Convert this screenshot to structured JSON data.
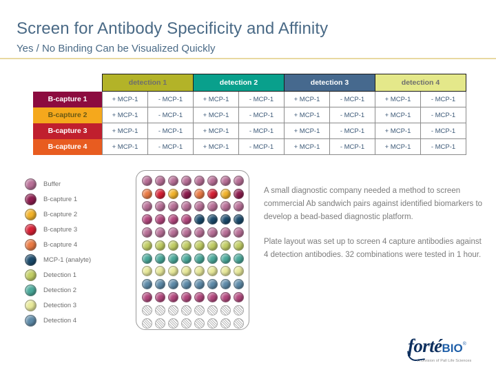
{
  "header": {
    "title": "Screen for Antibody Specificity and Affinity",
    "subtitle": "Yes / No Binding Can be Visualized Quickly",
    "title_color": "#4a6a86",
    "rule_color": "#e8d8a0"
  },
  "table": {
    "corner_label": "",
    "column_groups": [
      {
        "label": "detection 1",
        "bg": "#b3b328",
        "fg": "#6e6e6e"
      },
      {
        "label": "detection 2",
        "bg": "#09a08c",
        "fg": "#ffffff"
      },
      {
        "label": "detection 3",
        "bg": "#46698e",
        "fg": "#ffffff"
      },
      {
        "label": "detection 4",
        "bg": "#e4e88a",
        "fg": "#6e6e6e"
      }
    ],
    "subcolumns": [
      "+ MCP-1",
      "- MCP-1"
    ],
    "rows": [
      {
        "label": "B-capture 1",
        "bg": "#8c0b3f",
        "fg": "#ffffff",
        "cells": [
          "+ MCP-1",
          "- MCP-1",
          "+ MCP-1",
          "- MCP-1",
          "+ MCP-1",
          "- MCP-1",
          "+ MCP-1",
          "- MCP-1"
        ]
      },
      {
        "label": "B-capture 2",
        "bg": "#f5a81c",
        "fg": "#6b5a14",
        "cells": [
          "+ MCP-1",
          "- MCP-1",
          "+ MCP-1",
          "- MCP-1",
          "+ MCP-1",
          "- MCP-1",
          "+ MCP-1",
          "- MCP-1"
        ]
      },
      {
        "label": "B-capture 3",
        "bg": "#c01f2e",
        "fg": "#ffffff",
        "cells": [
          "+ MCP-1",
          "- MCP-1",
          "+ MCP-1",
          "- MCP-1",
          "+ MCP-1",
          "- MCP-1",
          "+ MCP-1",
          "- MCP-1"
        ]
      },
      {
        "label": "B-capture 4",
        "bg": "#e85c20",
        "fg": "#ffffff",
        "cells": [
          "+ MCP-1",
          "- MCP-1",
          "+ MCP-1",
          "- MCP-1",
          "+ MCP-1",
          "- MCP-1",
          "+ MCP-1",
          "- MCP-1"
        ]
      }
    ]
  },
  "legend": {
    "items": [
      {
        "label": "Buffer",
        "color": "#b86f97"
      },
      {
        "label": "B-capture 1",
        "color": "#8c1c4e"
      },
      {
        "label": "B-capture 2",
        "color": "#f2b32a"
      },
      {
        "label": "B-capture 3",
        "color": "#d61f34"
      },
      {
        "label": "B-capture 4",
        "color": "#ea7a44"
      },
      {
        "label": "MCP-1 (analyte)",
        "color": "#1b4a6b"
      },
      {
        "label": "Detection 1",
        "color": "#c2ce65"
      },
      {
        "label": "Detection 2",
        "color": "#4aa99a"
      },
      {
        "label": "Detection 3",
        "color": "#e8e99a"
      },
      {
        "label": "Detection 4",
        "color": "#5d8aa8"
      }
    ]
  },
  "plate": {
    "columns": 8,
    "rows": 12,
    "well_rows": [
      {
        "name": "buffer-row-1",
        "colors": [
          "#b86f97",
          "#b86f97",
          "#b86f97",
          "#b86f97",
          "#b86f97",
          "#b86f97",
          "#b86f97",
          "#b86f97"
        ]
      },
      {
        "name": "captures-row",
        "colors": [
          "#ea7a44",
          "#d61f34",
          "#f2b32a",
          "#8c1c4e",
          "#ea7a44",
          "#d61f34",
          "#f2b32a",
          "#8c1c4e"
        ]
      },
      {
        "name": "buffer-row-2",
        "colors": [
          "#b86f97",
          "#b86f97",
          "#b86f97",
          "#b86f97",
          "#b86f97",
          "#b86f97",
          "#b86f97",
          "#b86f97"
        ]
      },
      {
        "name": "analyte-row",
        "colors": [
          "#b3487e",
          "#b3487e",
          "#b3487e",
          "#b3487e",
          "#1b4a6b",
          "#1b4a6b",
          "#1b4a6b",
          "#1b4a6b"
        ]
      },
      {
        "name": "buffer-row-3",
        "colors": [
          "#b86f97",
          "#b86f97",
          "#b86f97",
          "#b86f97",
          "#b86f97",
          "#b86f97",
          "#b86f97",
          "#b86f97"
        ]
      },
      {
        "name": "detection-1-row",
        "colors": [
          "#c2ce65",
          "#c2ce65",
          "#c2ce65",
          "#c2ce65",
          "#c2ce65",
          "#c2ce65",
          "#c2ce65",
          "#c2ce65"
        ]
      },
      {
        "name": "detection-2-row",
        "colors": [
          "#4aa99a",
          "#4aa99a",
          "#4aa99a",
          "#4aa99a",
          "#4aa99a",
          "#4aa99a",
          "#4aa99a",
          "#4aa99a"
        ]
      },
      {
        "name": "detection-3-row",
        "colors": [
          "#e8e99a",
          "#e8e99a",
          "#e8e99a",
          "#e8e99a",
          "#e8e99a",
          "#e8e99a",
          "#e8e99a",
          "#e8e99a"
        ]
      },
      {
        "name": "detection-4-row",
        "colors": [
          "#5d8aa8",
          "#5d8aa8",
          "#5d8aa8",
          "#5d8aa8",
          "#5d8aa8",
          "#5d8aa8",
          "#5d8aa8",
          "#5d8aa8"
        ]
      },
      {
        "name": "buffer-row-4",
        "colors": [
          "#b3487e",
          "#b3487e",
          "#b3487e",
          "#b3487e",
          "#b3487e",
          "#b3487e",
          "#b3487e",
          "#b3487e"
        ]
      },
      {
        "name": "empty-row-1",
        "colors": [
          "empty",
          "empty",
          "empty",
          "empty",
          "empty",
          "empty",
          "empty",
          "empty"
        ]
      },
      {
        "name": "empty-row-2",
        "colors": [
          "empty",
          "empty",
          "empty",
          "empty",
          "empty",
          "empty",
          "empty",
          "empty"
        ]
      }
    ]
  },
  "body_copy": {
    "paragraphs": [
      "A small diagnostic company needed a method to screen commercial Ab sandwich pairs against identified biomarkers to develop a bead-based diagnostic platform.",
      "Plate layout was set up to screen 4 capture antibodies against 4 detection antibodies. 32 combinations were tested in 1 hour."
    ]
  },
  "logo": {
    "wordmark": "forté",
    "suffix": "BIO",
    "trademark": "®",
    "tagline": "A Division of Pall Life Sciences"
  }
}
